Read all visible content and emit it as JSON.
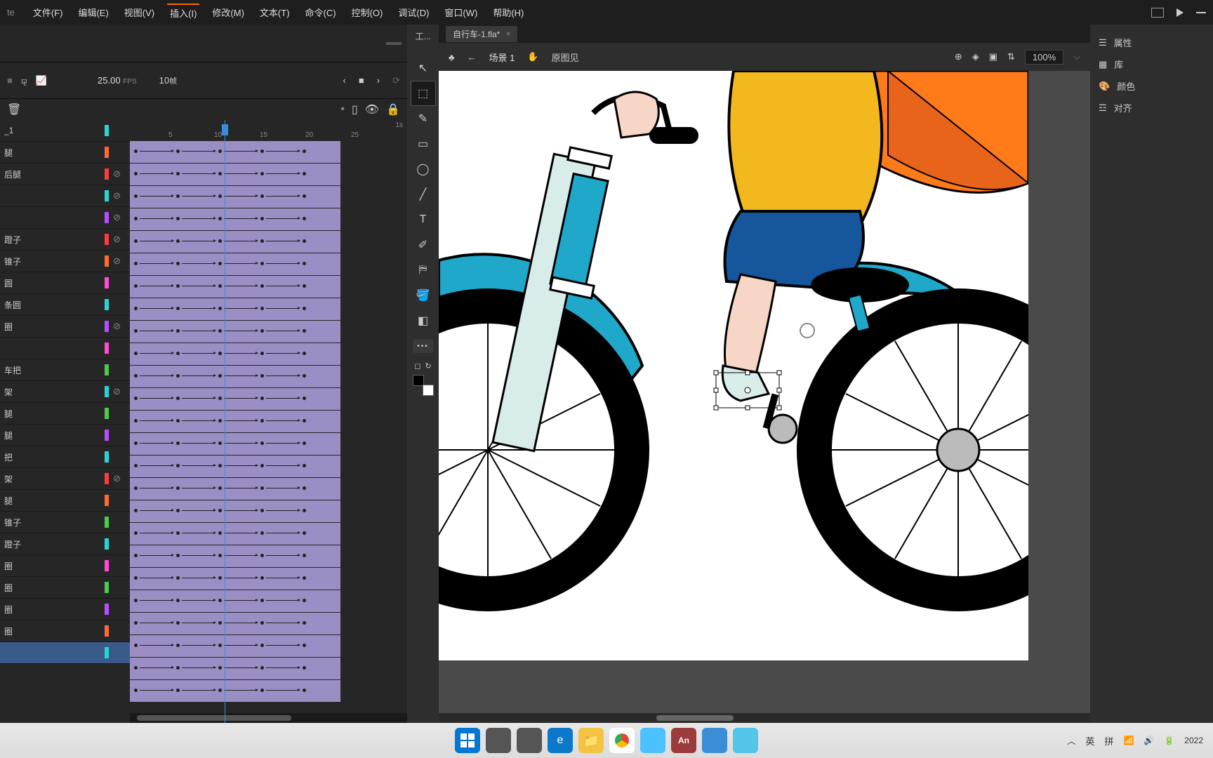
{
  "app": {
    "name_fragment": "te"
  },
  "menu": {
    "items": [
      "文件(F)",
      "编辑(E)",
      "视图(V)",
      "插入(I)",
      "修改(M)",
      "文本(T)",
      "命令(C)",
      "控制(O)",
      "调试(D)",
      "窗口(W)",
      "帮助(H)"
    ],
    "active_index": 3
  },
  "timeline": {
    "panel_tab": "工...",
    "fps": "25.00",
    "fps_unit": "FPS",
    "current_frame": "10",
    "frame_unit": "帧",
    "ruler_ticks": [
      "5",
      "10",
      "15",
      "20",
      "25"
    ],
    "ruler_sec": "1s",
    "layers": [
      {
        "name": "_1",
        "color": "#2ad4d4",
        "hidden": false
      },
      {
        "name": "腿",
        "color": "#ff6b2e",
        "hidden": false
      },
      {
        "name": "后腿",
        "color": "#ff3b3b",
        "hidden": true
      },
      {
        "name": "",
        "color": "#2ad4d4",
        "hidden": true
      },
      {
        "name": "",
        "color": "#b84dff",
        "hidden": true
      },
      {
        "name": "蹬子",
        "color": "#ff3b3b",
        "hidden": true
      },
      {
        "name": "锥子",
        "color": "#ff6b2e",
        "hidden": true
      },
      {
        "name": "圆",
        "color": "#ff4dd2",
        "hidden": false
      },
      {
        "name": "条圆",
        "color": "#2ad4d4",
        "hidden": false
      },
      {
        "name": "圈",
        "color": "#b84dff",
        "hidden": true
      },
      {
        "name": "",
        "color": "#ff4dd2",
        "hidden": false
      },
      {
        "name": "车把",
        "color": "#4dc94d",
        "hidden": false
      },
      {
        "name": "架",
        "color": "#2ad4d4",
        "hidden": true
      },
      {
        "name": "腿",
        "color": "#4dc94d",
        "hidden": false
      },
      {
        "name": "腿",
        "color": "#b84dff",
        "hidden": false
      },
      {
        "name": "把",
        "color": "#2ad4d4",
        "hidden": false
      },
      {
        "name": "架",
        "color": "#ff3b3b",
        "hidden": true
      },
      {
        "name": "腿",
        "color": "#ff6b2e",
        "hidden": false
      },
      {
        "name": "锥子",
        "color": "#4dc94d",
        "hidden": false
      },
      {
        "name": "蹬子",
        "color": "#2ad4d4",
        "hidden": false
      },
      {
        "name": "圈",
        "color": "#ff4dd2",
        "hidden": false
      },
      {
        "name": "圈",
        "color": "#4dc94d",
        "hidden": false
      },
      {
        "name": "圈",
        "color": "#b84dff",
        "hidden": false
      },
      {
        "name": "圈",
        "color": "#ff6b2e",
        "hidden": false
      },
      {
        "name": "",
        "color": "#2ad4d4",
        "hidden": false,
        "selected": true
      }
    ]
  },
  "tools": {
    "list": [
      {
        "name": "selection",
        "glyph": "↖"
      },
      {
        "name": "free-transform",
        "glyph": "⬚",
        "active": true
      },
      {
        "name": "brush",
        "glyph": "✎"
      },
      {
        "name": "rectangle",
        "glyph": "▭"
      },
      {
        "name": "oval",
        "glyph": "◯"
      },
      {
        "name": "line",
        "glyph": "╱"
      },
      {
        "name": "text",
        "glyph": "T"
      },
      {
        "name": "eyedropper",
        "glyph": "✐"
      },
      {
        "name": "camera",
        "glyph": "⛿"
      },
      {
        "name": "paint-bucket",
        "glyph": "🪣"
      },
      {
        "name": "eraser",
        "glyph": "◧"
      }
    ]
  },
  "document": {
    "tab_name": "自行车-1.fla*",
    "scene_label": "场景 1",
    "view_label": "原图见",
    "zoom": "100%"
  },
  "right_panels": {
    "items": [
      {
        "label": "属性",
        "icon": "sliders"
      },
      {
        "label": "库",
        "icon": "library"
      },
      {
        "label": "颜色",
        "icon": "palette"
      },
      {
        "label": "对齐",
        "icon": "align"
      }
    ]
  },
  "taskbar": {
    "apps": [
      {
        "name": "start",
        "color": "#0078d4"
      },
      {
        "name": "search",
        "color": "#555"
      },
      {
        "name": "task-view",
        "color": "#555"
      },
      {
        "name": "edge",
        "color": "#0b78c9"
      },
      {
        "name": "explorer",
        "color": "#f5c242"
      },
      {
        "name": "chrome",
        "color": "#ffffff"
      },
      {
        "name": "wechat",
        "color": "#4bc1ff"
      },
      {
        "name": "animate",
        "color": "#9b3b3b"
      },
      {
        "name": "app-blue",
        "color": "#3b8dd8"
      },
      {
        "name": "app-circle",
        "color": "#52c5e8"
      }
    ],
    "tray": {
      "chevron": "︿",
      "ime1": "英",
      "ime2": "拼",
      "wifi": "📶",
      "volume": "🔊",
      "battery": "🔋",
      "year": "2022"
    }
  }
}
